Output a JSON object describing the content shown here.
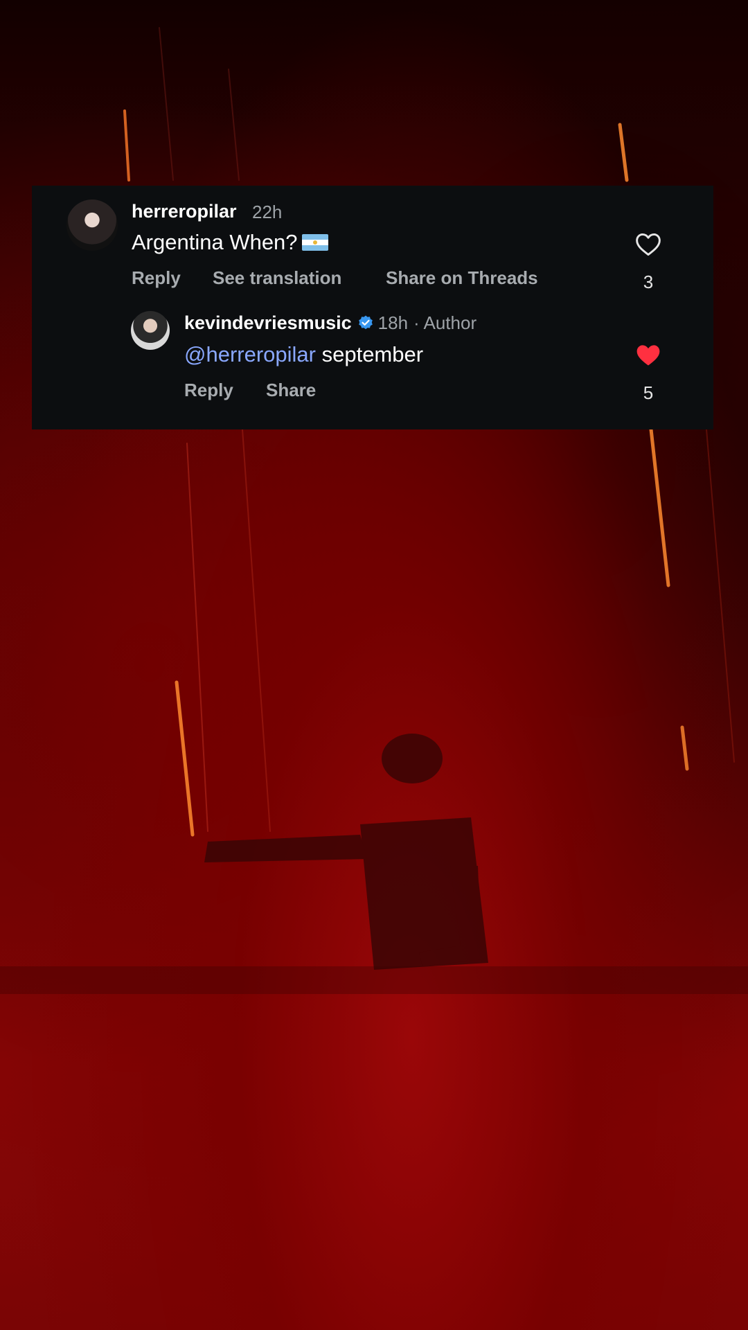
{
  "comment": {
    "username": "herreropilar",
    "time": "22h",
    "text": "Argentina When?",
    "flag_icon": "argentina-flag-emoji",
    "actions": {
      "reply": "Reply",
      "see_translation": "See translation",
      "share_threads": "Share on Threads"
    },
    "likes": "3",
    "liked": false
  },
  "reply": {
    "username": "kevindevriesmusic",
    "verified": true,
    "time": "18h",
    "author_label": "· Author",
    "mention": "@herreropilar",
    "text": " september",
    "actions": {
      "reply": "Reply",
      "share": "Share"
    },
    "likes": "5",
    "liked": true
  },
  "colors": {
    "card_bg": "#0c0e10",
    "mention": "#8aa8ff",
    "liked_heart": "#ff3040",
    "verified_badge": "#3897f0"
  }
}
